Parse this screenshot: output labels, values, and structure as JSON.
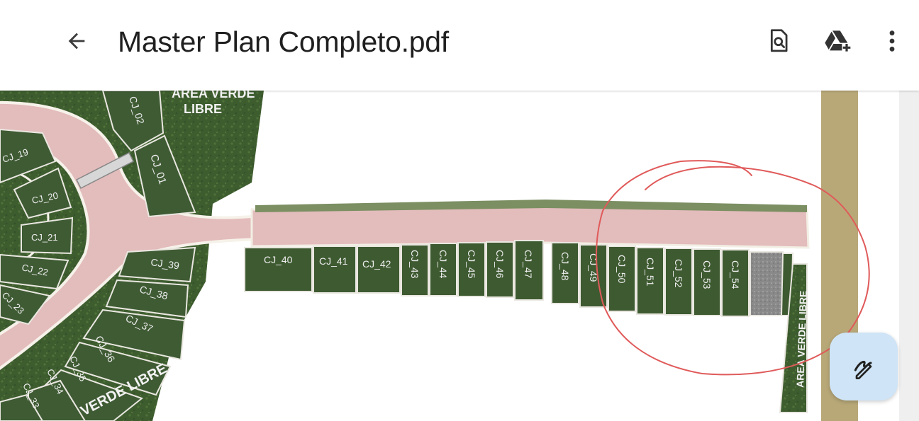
{
  "toolbar": {
    "title": "Master Plan Completo.pdf",
    "icons": [
      "arrow-left-icon",
      "document-search-icon",
      "drive-add-icon",
      "more-vert-icon"
    ]
  },
  "plan": {
    "label_area_top": "AREA VERDE LIBRE",
    "label_area_top_line1": "AREA VERDE",
    "label_area_top_line2": "LIBRE",
    "label_area_right": "AREA VERDE LIBRE",
    "label_area_bottom": "VERDE LIBRE",
    "lots_north_curve": [
      "CJ_02",
      "CJ_01"
    ],
    "lots_left_ring": [
      "CJ_19",
      "CJ_20",
      "CJ_21",
      "CJ_22",
      "CJ_23"
    ],
    "lots_left_lower": [
      "CJ_39",
      "CJ_38",
      "CJ_37",
      "CJ_36",
      "CJ_35",
      "CJ_34",
      "CJ_33"
    ],
    "lots_row_horizontal": [
      "CJ_40",
      "CJ_41",
      "CJ_42"
    ],
    "lots_row_vertical": [
      "CJ_43",
      "CJ_44",
      "CJ_45",
      "CJ_46",
      "CJ_47",
      "CJ_48",
      "CJ_49",
      "CJ_50",
      "CJ_51",
      "CJ_52",
      "CJ_53",
      "CJ_54"
    ],
    "colors": {
      "lot": "#3d5a31",
      "road": "#e3bcbc",
      "annotation": "#e05a5a",
      "strip": "#b8a878"
    }
  },
  "fab": {
    "icon": "annotate-pen-icon"
  }
}
